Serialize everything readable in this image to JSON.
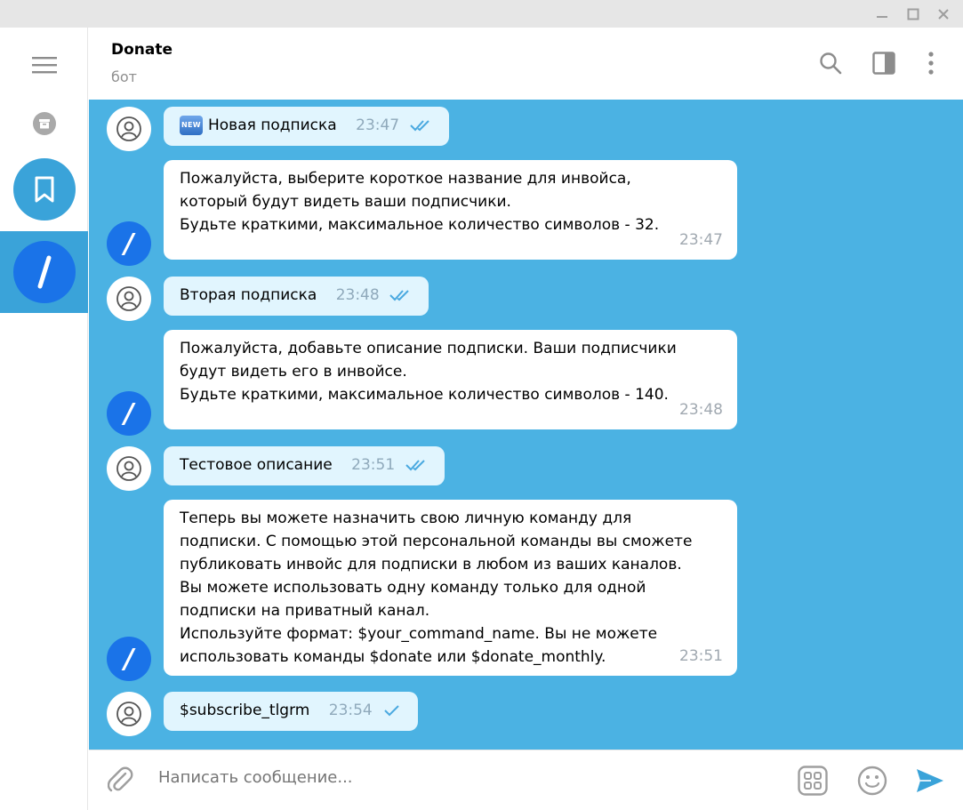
{
  "chat": {
    "title": "Donate",
    "subtitle": "бот"
  },
  "composer": {
    "placeholder": "Написать сообщение..."
  },
  "messages": [
    {
      "type": "out",
      "badge": "NEW",
      "text": "Новая подписка",
      "time": "23:47",
      "status": "read"
    },
    {
      "type": "in",
      "text": "Пожалуйста, выберите короткое название для инвойса,\nкоторый будут видеть ваши подписчики.\nБудьте краткими, максимальное количество символов - 32.",
      "time": "23:47"
    },
    {
      "type": "out",
      "text": "Вторая подписка",
      "time": "23:48",
      "status": "read"
    },
    {
      "type": "in",
      "text": "Пожалуйста, добавьте описание подписки. Ваши подписчики\nбудут видеть его в инвойсе.\nБудьте краткими, максимальное количество символов - 140.",
      "time": "23:48"
    },
    {
      "type": "out",
      "text": "Тестовое описание",
      "time": "23:51",
      "status": "read"
    },
    {
      "type": "in",
      "text": "Теперь вы можете назначить свою личную команду для\nподписки. С помощью этой персональной команды вы сможете\nпубликовать инвойс для подписки в любом из ваших каналов.\nВы можете использовать одну команду только для одной\nподписки на приватный канал.\nИспользуйте формат: $your_command_name. Вы не можете\nиспользовать команды $donate или $donate_monthly.",
      "time": "23:51"
    },
    {
      "type": "out",
      "text": "$subscribe_tlgrm",
      "time": "23:54",
      "status": "sent"
    }
  ],
  "bot_avatar_glyph": "/",
  "colors": {
    "accent": "#3aa3d9",
    "chat_background": "#4bb2e3",
    "outgoing_bubble": "#e1f5fe",
    "incoming_bubble": "#ffffff",
    "bot_avatar": "#1a73e8",
    "tick": "#4aa9e0"
  },
  "icons": {
    "window": [
      "minimize-icon",
      "maximize-icon",
      "close-icon"
    ],
    "sidebar": [
      "menu-icon",
      "archive-icon",
      "bookmark-icon",
      "bot-folder-icon"
    ],
    "header": [
      "search-icon",
      "sidebar-toggle-icon",
      "more-vertical-icon"
    ],
    "composer": [
      "attach-icon",
      "commands-icon",
      "emoji-icon",
      "send-icon"
    ]
  }
}
